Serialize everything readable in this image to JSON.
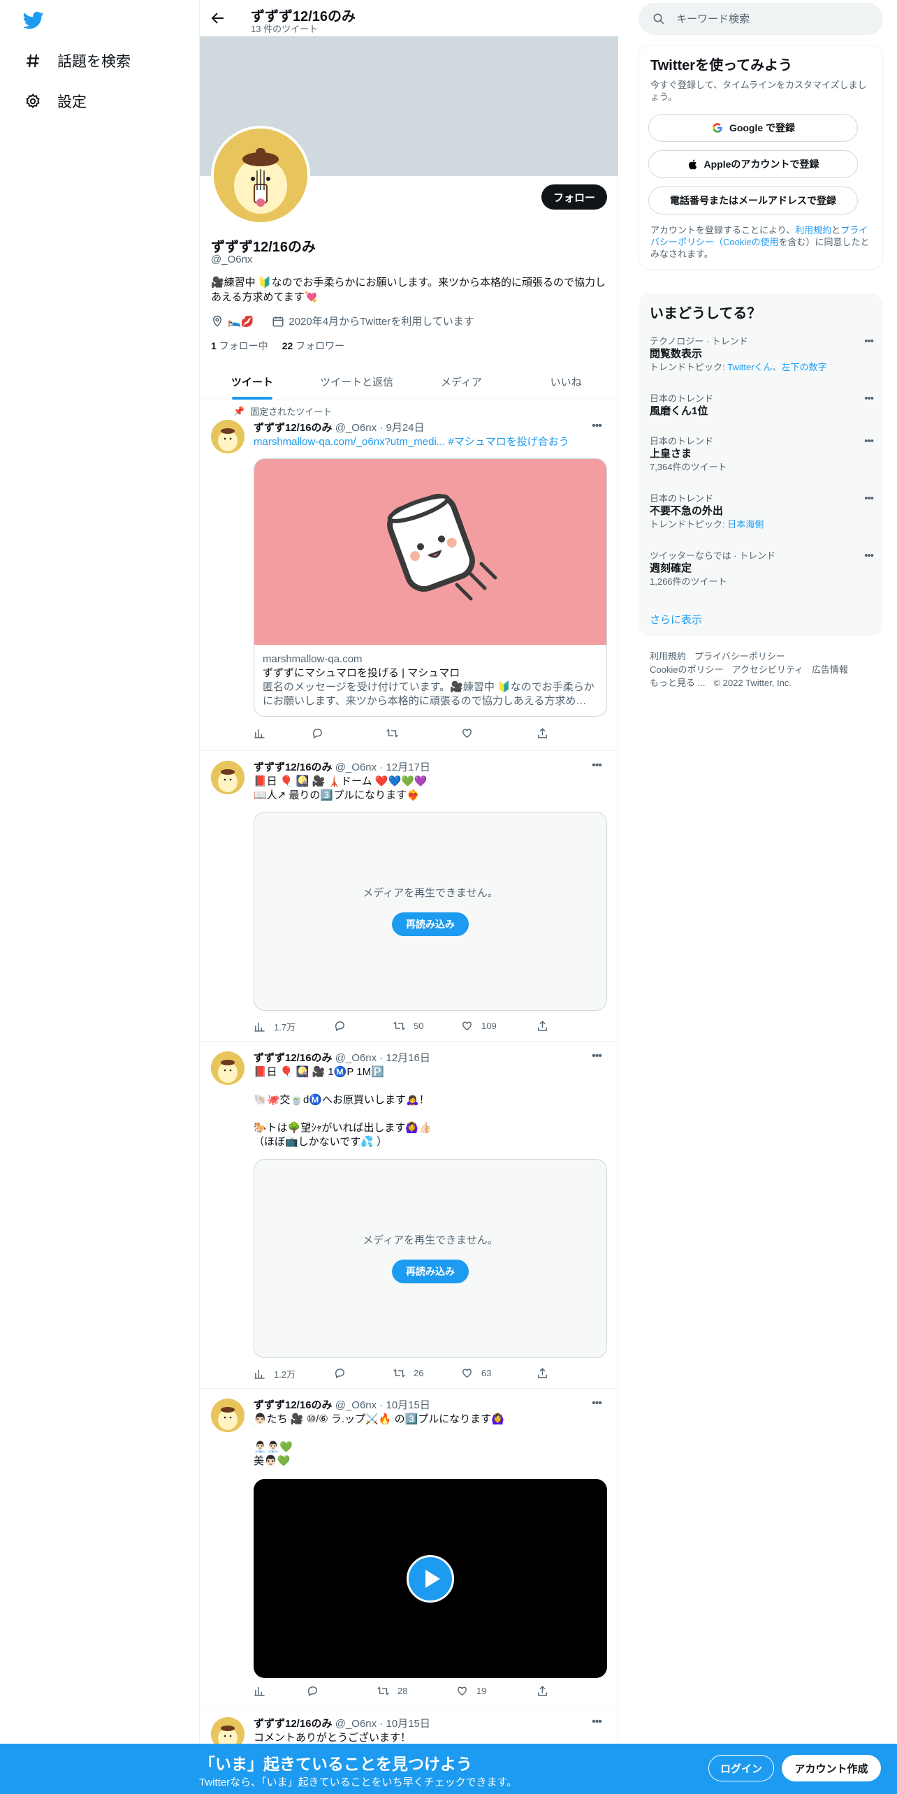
{
  "brand": {
    "accent": "#1d9bf0",
    "text": "#0f1419",
    "muted": "#536471",
    "banner": "#cfd9de",
    "card_image_bg": "#f29ea1"
  },
  "nav": {
    "explore": "話題を検索",
    "settings": "設定"
  },
  "header": {
    "title": "ずずず12/16のみ",
    "subtitle": "13 件のツイート"
  },
  "profile": {
    "name": "ずずず12/16のみ",
    "handle": "@_O6nx",
    "follow": "フォロー",
    "bio": "🎥練習中 🔰なのでお手柔らかにお願いします。来ツから本格的に頑張るので協力しあえる方求めてます💘",
    "location": "🛌💋",
    "joined": "2020年4月からTwitterを利用しています",
    "following_count": "1",
    "following_label": "フォロー中",
    "followers_count": "22",
    "followers_label": "フォロワー"
  },
  "tabs": [
    "ツイート",
    "ツイートと返信",
    "メディア",
    "いいね"
  ],
  "tweets": [
    {
      "pinned_label": "固定されたツイート",
      "name": "ずずず12/16のみ",
      "meta": "@_O6nx · 9月24日",
      "link": "marshmallow-qa.com/_o6nx?utm_medi...",
      "hashtag": "#マシュマロを投げ合おう",
      "card": {
        "domain": "marshmallow-qa.com",
        "title": "ずずずにマシュマロを投げる | マシュマロ",
        "desc": "匿名のメッセージを受け付けています。🎥練習中 🔰なのでお手柔らかにお願いします、来ツから本格的に頑張るので協力しあえる方求め…"
      },
      "stats": {
        "views": "",
        "retweets": "",
        "likes": ""
      }
    },
    {
      "name": "ずずず12/16のみ",
      "meta": "@_O6nx · 12月17日",
      "text": "📕日 🎈 🎑 🎥 🗼ドーム ❤️💙💚💜\n📖人↗ 最りの3️⃣プルになります❤️‍🔥",
      "media_msg": "メディアを再生できません。",
      "reload": "再読み込み",
      "stats": {
        "views": "1.7万",
        "retweets": "50",
        "likes": "109"
      }
    },
    {
      "name": "ずずず12/16のみ",
      "meta": "@_O6nx · 12月16日",
      "text": "📕日 🎈 🎑 🎥 1Ⓜ️P 1M🅿️\n\n🐚🐙交🍵dⓂ️へお原買いします🙇‍♀️！\n\n🐎トは🌳望ｼｬがいれば出します🙆‍♀️👍🏻\n（ほぼ📺しかないです💦 ）",
      "media_msg": "メディアを再生できません。",
      "reload": "再読み込み",
      "stats": {
        "views": "1.2万",
        "retweets": "26",
        "likes": "63"
      }
    },
    {
      "name": "ずずず12/16のみ",
      "meta": "@_O6nx · 10月15日",
      "text": "👨🏻たち 🎥 ⑩/⑥ ラ.ップ⚔️🔥 の3️⃣プルになります🙆‍♀️\n\n👨🏻‍💼👨🏻‍💼💚\n美👨🏻💚",
      "stats": {
        "views": "",
        "retweets": "28",
        "likes": "19"
      }
    },
    {
      "name": "ずずず12/16のみ",
      "meta": "@_O6nx · 10月15日",
      "text": "コメントありがとうございます！"
    }
  ],
  "search": {
    "placeholder": "キーワード検索"
  },
  "signup_box": {
    "title": "Twitterを使ってみよう",
    "sub": "今すぐ登録して、タイムラインをカスタマイズしましょう。",
    "google": "Google で登録",
    "apple": "Appleのアカウントで登録",
    "phone": "電話番号またはメールアドレスで登録",
    "terms_pre": "アカウントを登録することにより、",
    "terms_link1": "利用規約",
    "terms_and": "と",
    "terms_link2": "プライバシーポリシー（Cookieの使用",
    "terms_post": "を含む）に同意したとみなされます。"
  },
  "trends": {
    "title": "いまどうしてる？",
    "items": [
      {
        "context": "テクノロジー · トレンド",
        "name": "閲覧数表示",
        "extra_prefix": "トレンドトピック: ",
        "extra_link": "Twitterくん、左下の数字"
      },
      {
        "context": "日本のトレンド",
        "name": "風磨くん1位"
      },
      {
        "context": "日本のトレンド",
        "name": "上皇さま",
        "extra": "7,364件のツイート"
      },
      {
        "context": "日本のトレンド",
        "name": "不要不急の外出",
        "extra_prefix": "トレンドトピック: ",
        "extra_link": "日本海側"
      },
      {
        "context": "ツイッターならでは · トレンド",
        "name": "週刻確定",
        "extra": "1,266件のツイート"
      }
    ],
    "show_more": "さらに表示"
  },
  "footer": {
    "links": [
      "利用規約",
      "プライバシーポリシー",
      "Cookieのポリシー",
      "アクセシビリティ",
      "広告情報",
      "もっと見る ..."
    ],
    "copyright": "© 2022 Twitter, Inc."
  },
  "bottom_bar": {
    "title": "「いま」起きていることを見つけよう",
    "sub": "Twitterなら、「いま」起きていることをいち早くチェックできます。",
    "login": "ログイン",
    "signup": "アカウント作成"
  }
}
